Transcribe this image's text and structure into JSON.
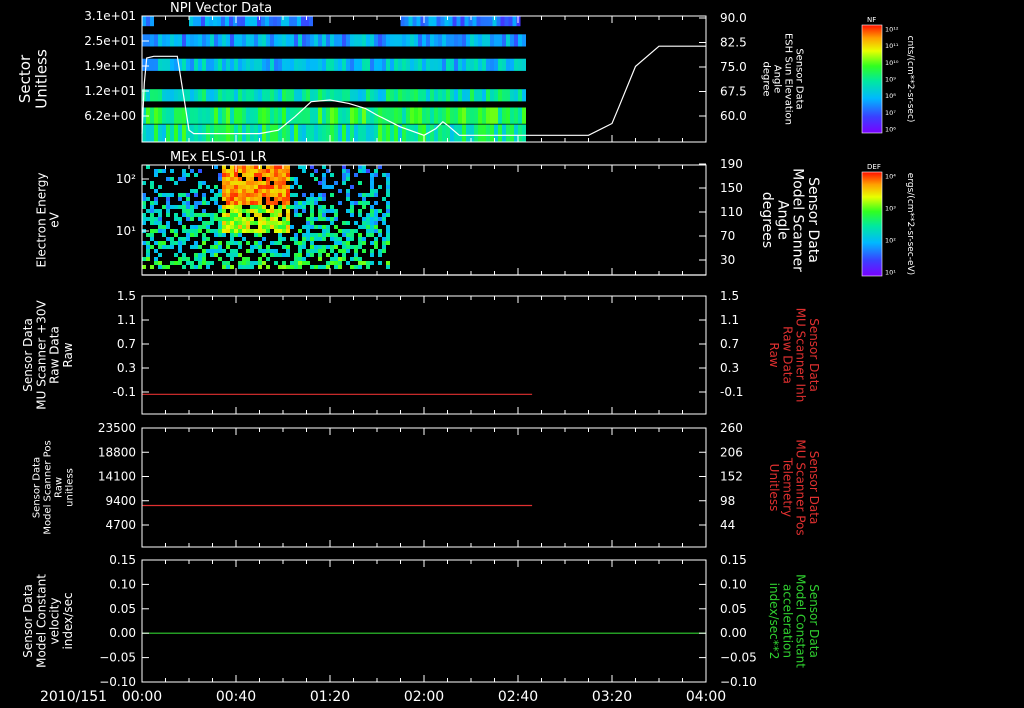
{
  "chart_data": [
    {
      "type": "heatmap",
      "title": "NPI Vector Data",
      "ylabel": "Sector\nUnitless",
      "y_ticks": [
        "3.1e+01",
        "2.5e+01",
        "1.9e+01",
        "1.2e+01",
        "6.2e+00"
      ],
      "ylim": [
        0,
        31
      ],
      "y2label": "Sensor Data\nESH Sun Elevation\nAngle\ndegree",
      "y2_ticks": [
        "90.0",
        "82.5",
        "75.0",
        "67.5",
        "60.0"
      ],
      "y2lim": [
        52.5,
        90.0
      ],
      "colorbar": {
        "label": "NF",
        "units": "cnts/(cm**2-sr-sec)",
        "ticks": [
          "10¹²",
          "10¹¹",
          "10¹⁰",
          "10⁹",
          "10⁸",
          "10⁷",
          "10⁶"
        ]
      },
      "data_extent_min": [
        0,
        162
      ],
      "rows": [
        {
          "y": [
            28.5,
            31.0
          ],
          "segments": [
            [
              0,
              5
            ],
            [
              20,
              72
            ],
            [
              110,
              160
            ]
          ],
          "level": 0.25
        },
        {
          "y": [
            23.5,
            26.5
          ],
          "segments": [
            [
              0,
              162
            ]
          ],
          "level": 0.3
        },
        {
          "y": [
            17.5,
            20.5
          ],
          "segments": [
            [
              0,
              162
            ]
          ],
          "level": 0.35
        },
        {
          "y": [
            10.0,
            13.0
          ],
          "segments": [
            [
              0,
              162
            ]
          ],
          "level": 0.45
        },
        {
          "y": [
            4.5,
            8.5
          ],
          "segments": [
            [
              0,
              162
            ]
          ],
          "level": 0.55
        }
      ],
      "series": [
        {
          "name": "ESH Sun Elevation Angle",
          "color": "#ffffff",
          "axis": "right",
          "x": [
            0,
            1,
            2,
            5,
            10,
            15,
            18,
            20,
            22,
            30,
            50,
            58,
            65,
            72,
            80,
            88,
            95,
            100,
            110,
            120,
            125,
            128,
            130,
            135,
            140,
            150,
            162,
            180,
            190,
            200,
            203,
            210,
            220,
            230,
            240
          ],
          "y": [
            55.0,
            70.0,
            77.5,
            78.0,
            78.0,
            78.0,
            65.0,
            56.0,
            55.0,
            55.0,
            55.0,
            56.0,
            60.0,
            64.5,
            65.0,
            64.0,
            62.5,
            60.5,
            57.0,
            54.5,
            56.5,
            58.5,
            57.5,
            54.5,
            54.5,
            54.5,
            54.5,
            54.5,
            54.5,
            58.0,
            63.0,
            75.0,
            81.0,
            81.0,
            81.0
          ]
        }
      ]
    },
    {
      "type": "heatmap",
      "title": "MEx ELS-01 LR",
      "ylabel": "Electron Energy\neV",
      "y_ticks": [
        "10²",
        "10¹"
      ],
      "ylim_log10": [
        0.18,
        2.3
      ],
      "y2label": "Sensor Data\nModel Scanner\nAngle\ndegrees",
      "y2_ticks": [
        "190",
        "150",
        "110",
        "70",
        "30"
      ],
      "y2lim": [
        10,
        190
      ],
      "colorbar": {
        "label": "DEF",
        "units": "ergs/(cm**2-sr-sec-eV)",
        "ticks": [
          "10⁴",
          "10³",
          "10²",
          "10¹"
        ]
      },
      "data_extent_min": [
        0,
        104
      ],
      "series": [
        {
          "name": "Model Scanner Angle",
          "color": "#ffffff",
          "axis": "right",
          "x": [
            0,
            240
          ],
          "y": [
            10,
            10
          ]
        }
      ]
    },
    {
      "type": "line",
      "ylabel": "Sensor Data\nMU Scanner +30V\nRaw Data\nRaw",
      "y_ticks": [
        "1.5",
        "1.1",
        "0.7",
        "0.3",
        "-0.1"
      ],
      "ylim": [
        -0.3,
        1.5
      ],
      "y2label": "Sensor Data\nMU Scanner Inh\nRaw Data\nRaw",
      "y2_ticks": [
        "1.5",
        "1.1",
        "0.7",
        "0.3",
        "-0.1"
      ],
      "y2lim": [
        -0.3,
        1.5
      ],
      "series": [
        {
          "name": "MU Scanner +30V Raw Data",
          "color": "#e03030",
          "x": [
            0,
            166
          ],
          "y": [
            0.0,
            0.0
          ]
        }
      ]
    },
    {
      "type": "line",
      "ylabel": "Sensor Data\nModel Scanner Pos\nRaw\nunitless",
      "y_ticks": [
        "23500",
        "18800",
        "14100",
        "9400",
        "4700"
      ],
      "ylim": [
        0,
        23500
      ],
      "y2label": "Sensor Data\nMU Scanner Pos\nTelemetry\nUnitless",
      "y2_ticks": [
        "260",
        "206",
        "152",
        "98",
        "44"
      ],
      "y2lim": [
        -10,
        260
      ],
      "series": [
        {
          "name": "Model Scanner Pos Raw",
          "color": "#e03030",
          "x": [
            0,
            166
          ],
          "y": [
            8200,
            8200
          ]
        }
      ]
    },
    {
      "type": "line",
      "ylabel": "Sensor Data\nModel Constant\nvelocity\nindex/sec",
      "y_ticks": [
        "0.15",
        "0.10",
        "0.05",
        "0.00",
        "−0.05",
        "−0.10"
      ],
      "ylim": [
        -0.1,
        0.15
      ],
      "y2label": "Sensor Data\nModel Constant\nacceleration\nindex/sec**2",
      "y2_ticks": [
        "0.15",
        "0.10",
        "0.05",
        "0.00",
        "−0.05",
        "−0.10"
      ],
      "y2lim": [
        -0.1,
        0.15
      ],
      "series": [
        {
          "name": "Model Constant velocity",
          "color": "#30d030",
          "x": [
            0,
            240
          ],
          "y": [
            0.0,
            0.0
          ]
        }
      ]
    }
  ],
  "time_axis": {
    "date_label": "2010/151",
    "ticks": [
      "00:00",
      "00:40",
      "01:20",
      "02:00",
      "02:40",
      "03:20",
      "04:00"
    ],
    "range_min": [
      0,
      240
    ]
  },
  "colors": {
    "background": "#000000",
    "axes": "#ffffff",
    "right_label_red": "#e03030",
    "right_label_green": "#30d030"
  }
}
